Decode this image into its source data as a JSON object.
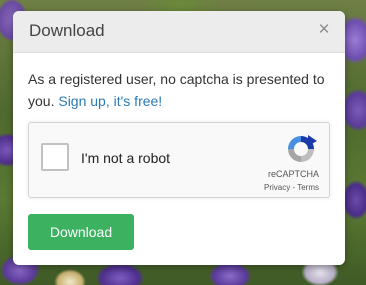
{
  "dialog": {
    "title": "Download",
    "close_glyph": "×",
    "close_icon": "close-icon",
    "message": "As a registered user, no captcha is presented to you.",
    "signup_link": "Sign up, it's free!",
    "download_label": "Download"
  },
  "captcha": {
    "label": "I'm not a robot",
    "brand": "reCAPTCHA",
    "privacy": "Privacy",
    "separator": " - ",
    "terms": "Terms",
    "logo_icon": "recaptcha-logo-icon"
  },
  "colors": {
    "download_button": "#3cb160",
    "link": "#2a7ab8",
    "header_bg": "#ececec"
  }
}
